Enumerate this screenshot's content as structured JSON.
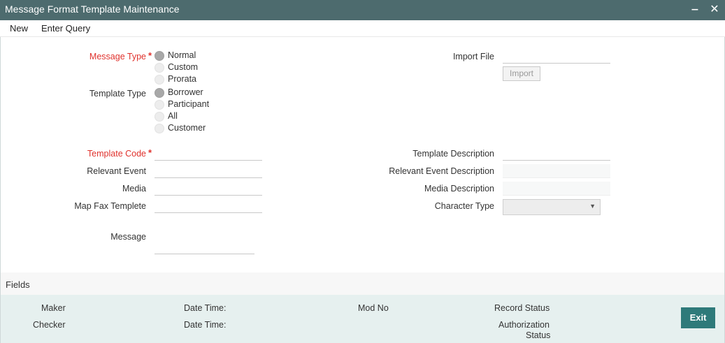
{
  "window": {
    "title": "Message Format Template Maintenance",
    "minimize_glyph": "‒",
    "close_glyph": "✕"
  },
  "menu": {
    "new": "New",
    "enter_query": "Enter Query"
  },
  "form": {
    "message_type": {
      "label": "Message Type",
      "required_mark": "*",
      "options": [
        "Normal",
        "Custom",
        "Prorata"
      ],
      "selected": "Normal"
    },
    "template_type": {
      "label": "Template Type",
      "options": [
        "Borrower",
        "Participant",
        "All",
        "Customer"
      ],
      "selected": "Borrower"
    },
    "import_file": {
      "label": "Import File",
      "value": "",
      "button_label": "Import"
    },
    "template_code": {
      "label": "Template Code",
      "required_mark": "*",
      "value": ""
    },
    "relevant_event": {
      "label": "Relevant Event",
      "value": ""
    },
    "media": {
      "label": "Media",
      "value": ""
    },
    "map_fax_template": {
      "label": "Map Fax Templete",
      "value": ""
    },
    "message": {
      "label": "Message",
      "value": ""
    },
    "template_description": {
      "label": "Template Description",
      "value": ""
    },
    "relevant_event_description": {
      "label": "Relevant Event Description",
      "value": ""
    },
    "media_description": {
      "label": "Media Description",
      "value": ""
    },
    "character_type": {
      "label": "Character Type",
      "value": "",
      "caret_glyph": "▼"
    }
  },
  "fields_section": {
    "label": "Fields"
  },
  "audit": {
    "maker": "Maker",
    "checker": "Checker",
    "date_time_1": "Date Time:",
    "date_time_2": "Date Time:",
    "mod_no": "Mod No",
    "record_status": "Record Status",
    "authorization": "Authorization",
    "status": "Status"
  },
  "actions": {
    "exit": "Exit"
  },
  "colors": {
    "titlebar": "#4d6b6e",
    "required": "#e0322d",
    "footer": "#e6f0ef",
    "exit_button": "#2e7a7a"
  }
}
